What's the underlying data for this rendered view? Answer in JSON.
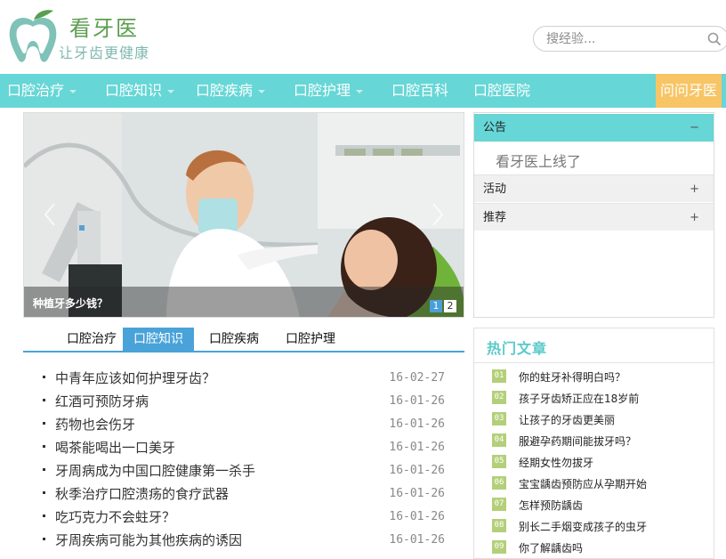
{
  "header": {
    "brand_name": "看牙医",
    "slogan": "让牙齿更健康",
    "search_placeholder": "搜经验..."
  },
  "nav": {
    "items": [
      {
        "label": "口腔治疗",
        "has_dropdown": true
      },
      {
        "label": "口腔知识",
        "has_dropdown": true
      },
      {
        "label": "口腔疾病",
        "has_dropdown": true
      },
      {
        "label": "口腔护理",
        "has_dropdown": true
      },
      {
        "label": "口腔百科",
        "has_dropdown": false
      },
      {
        "label": "口腔医院",
        "has_dropdown": false
      }
    ],
    "ask_label": "问问牙医"
  },
  "slider": {
    "caption": "种植牙多少钱？",
    "dots": [
      "1",
      "2"
    ],
    "active_dot": 1
  },
  "notice_panel": {
    "sections": [
      {
        "label": "公告",
        "sign": "−",
        "expanded": true
      },
      {
        "label": "活动",
        "sign": "+",
        "expanded": false
      },
      {
        "label": "推荐",
        "sign": "+",
        "expanded": false
      }
    ],
    "notice_text": "看牙医上线了"
  },
  "tabs": {
    "items": [
      "口腔治疗",
      "口腔知识",
      "口腔疾病",
      "口腔护理"
    ],
    "active_index": 1
  },
  "articles": [
    {
      "title": "中青年应该如何护理牙齿？",
      "date": "16-02-27"
    },
    {
      "title": "红酒可预防牙病",
      "date": "16-01-26"
    },
    {
      "title": "药物也会伤牙",
      "date": "16-01-26"
    },
    {
      "title": "喝茶能喝出一口美牙",
      "date": "16-01-26"
    },
    {
      "title": "牙周病成为中国口腔健康第一杀手",
      "date": "16-01-26"
    },
    {
      "title": "秋季治疗口腔溃疡的食疗武器",
      "date": "16-01-26"
    },
    {
      "title": "吃巧克力不会蛀牙？",
      "date": "16-01-26"
    },
    {
      "title": "牙周疾病可能为其他疾病的诱因",
      "date": "16-01-26"
    }
  ],
  "hot": {
    "title": "热门文章",
    "items": [
      {
        "num": "01",
        "title": "你的蛀牙补得明白吗？"
      },
      {
        "num": "02",
        "title": "孩子牙齿矫正应在18岁前"
      },
      {
        "num": "03",
        "title": "让孩子的牙齿更美丽"
      },
      {
        "num": "04",
        "title": "服避孕药期间能拔牙吗？"
      },
      {
        "num": "05",
        "title": "经期女性勿拔牙"
      },
      {
        "num": "06",
        "title": "宝宝龋齿预防应从孕期开始"
      },
      {
        "num": "07",
        "title": "怎样预防龋齿"
      },
      {
        "num": "08",
        "title": "别长二手烟变成孩子的虫牙"
      },
      {
        "num": "09",
        "title": "你了解龋齿吗"
      }
    ]
  },
  "colors": {
    "nav_bg": "#66d6d6",
    "ask_bg": "#f7c565",
    "tab_accent": "#4aa3d8",
    "hot_title": "#5ac9c9",
    "hot_badge": "#b4cf7a",
    "brand_green": "#5a9e4f"
  }
}
